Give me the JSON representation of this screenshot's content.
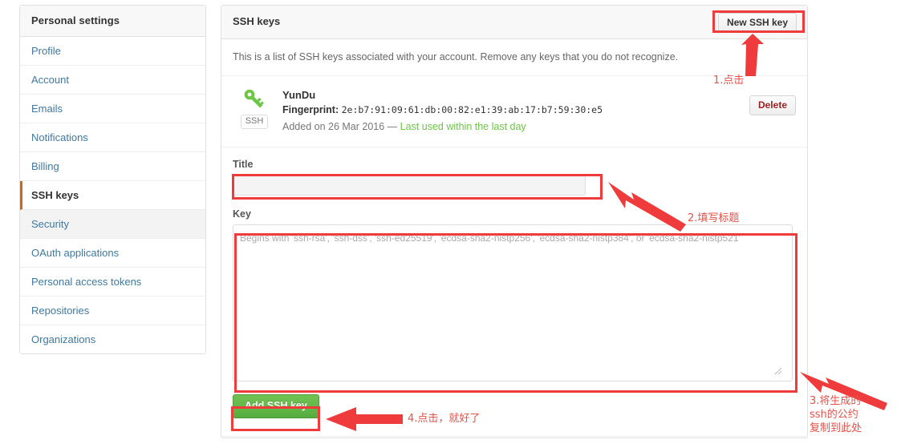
{
  "sidebar": {
    "header": "Personal settings",
    "items": [
      {
        "label": "Profile",
        "state": "normal"
      },
      {
        "label": "Account",
        "state": "normal"
      },
      {
        "label": "Emails",
        "state": "normal"
      },
      {
        "label": "Notifications",
        "state": "normal"
      },
      {
        "label": "Billing",
        "state": "normal"
      },
      {
        "label": "SSH keys",
        "state": "active"
      },
      {
        "label": "Security",
        "state": "hovered"
      },
      {
        "label": "OAuth applications",
        "state": "normal"
      },
      {
        "label": "Personal access tokens",
        "state": "normal"
      },
      {
        "label": "Repositories",
        "state": "normal"
      },
      {
        "label": "Organizations",
        "state": "normal"
      }
    ]
  },
  "main": {
    "title": "SSH keys",
    "new_key_button": "New SSH key",
    "description": "This is a list of SSH keys associated with your account. Remove any keys that you do not recognize.",
    "key_entry": {
      "icon": "key-icon",
      "badge": "SSH",
      "title": "YunDu",
      "fingerprint_label": "Fingerprint:",
      "fingerprint": "2e:b7:91:09:61:db:00:82:e1:39:ab:17:b7:59:30:e5",
      "added_text": "Added on 26 Mar 2016 —",
      "last_used": "Last used within the last day",
      "delete_button": "Delete"
    },
    "form": {
      "title_label": "Title",
      "title_value": "",
      "title_placeholder": "",
      "key_label": "Key",
      "key_value": "",
      "key_placeholder": "Begins with 'ssh-rsa', 'ssh-dss', 'ssh-ed25519', 'ecdsa-sha2-nistp256', 'ecdsa-sha2-nistp384', or 'ecdsa-sha2-nistp521'",
      "submit_button": "Add SSH key"
    }
  },
  "annotations": {
    "color": "#e8504a",
    "highlight_color": "#ef3b3b",
    "step1": "1.点击",
    "step2": "2.填写标题",
    "step3_line1": "3.将生成的",
    "step3_line2": "ssh的公约",
    "step3_line3": "复制到此处",
    "step4": "4.点击，就好了"
  }
}
